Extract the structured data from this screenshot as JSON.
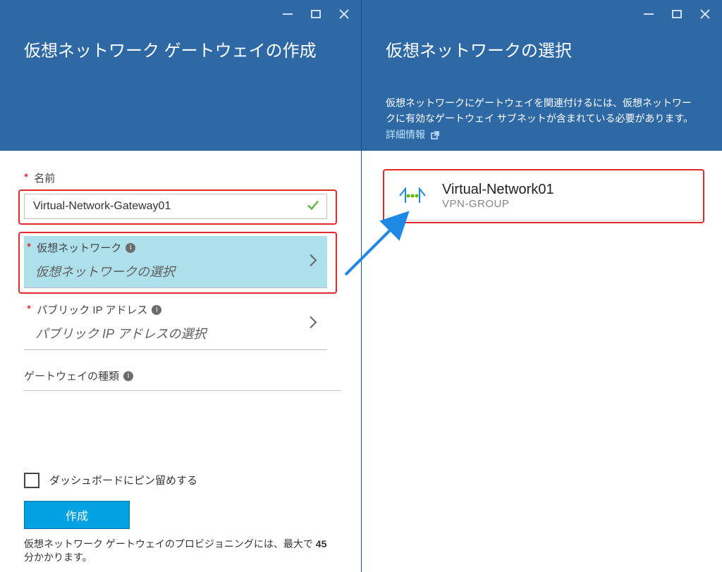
{
  "left_blade": {
    "title": "仮想ネットワーク ゲートウェイの作成",
    "fields": {
      "name_label": "名前",
      "name_value": "Virtual-Network-Gateway01",
      "vnet_label": "仮想ネットワーク",
      "vnet_placeholder": "仮想ネットワークの選択",
      "pip_label": "パブリック IP アドレス",
      "pip_placeholder": "パブリック IP アドレスの選択",
      "gwtype_label": "ゲートウェイの種類"
    },
    "footer": {
      "pin_label": "ダッシュボードにピン留めする",
      "create_label": "作成",
      "note_prefix": "仮想ネットワーク ゲートウェイのプロビジョニングには、最大で ",
      "note_bold": "45",
      "note_suffix": " 分かかります。"
    }
  },
  "right_blade": {
    "title": "仮想ネットワークの選択",
    "desc_text": "仮想ネットワークにゲートウェイを関連付けるには、仮想ネットワークに有効なゲートウェイ サブネットが含まれている必要があります。",
    "desc_link": "詳細情報",
    "item": {
      "name": "Virtual-Network01",
      "group": "VPN-GROUP"
    }
  }
}
